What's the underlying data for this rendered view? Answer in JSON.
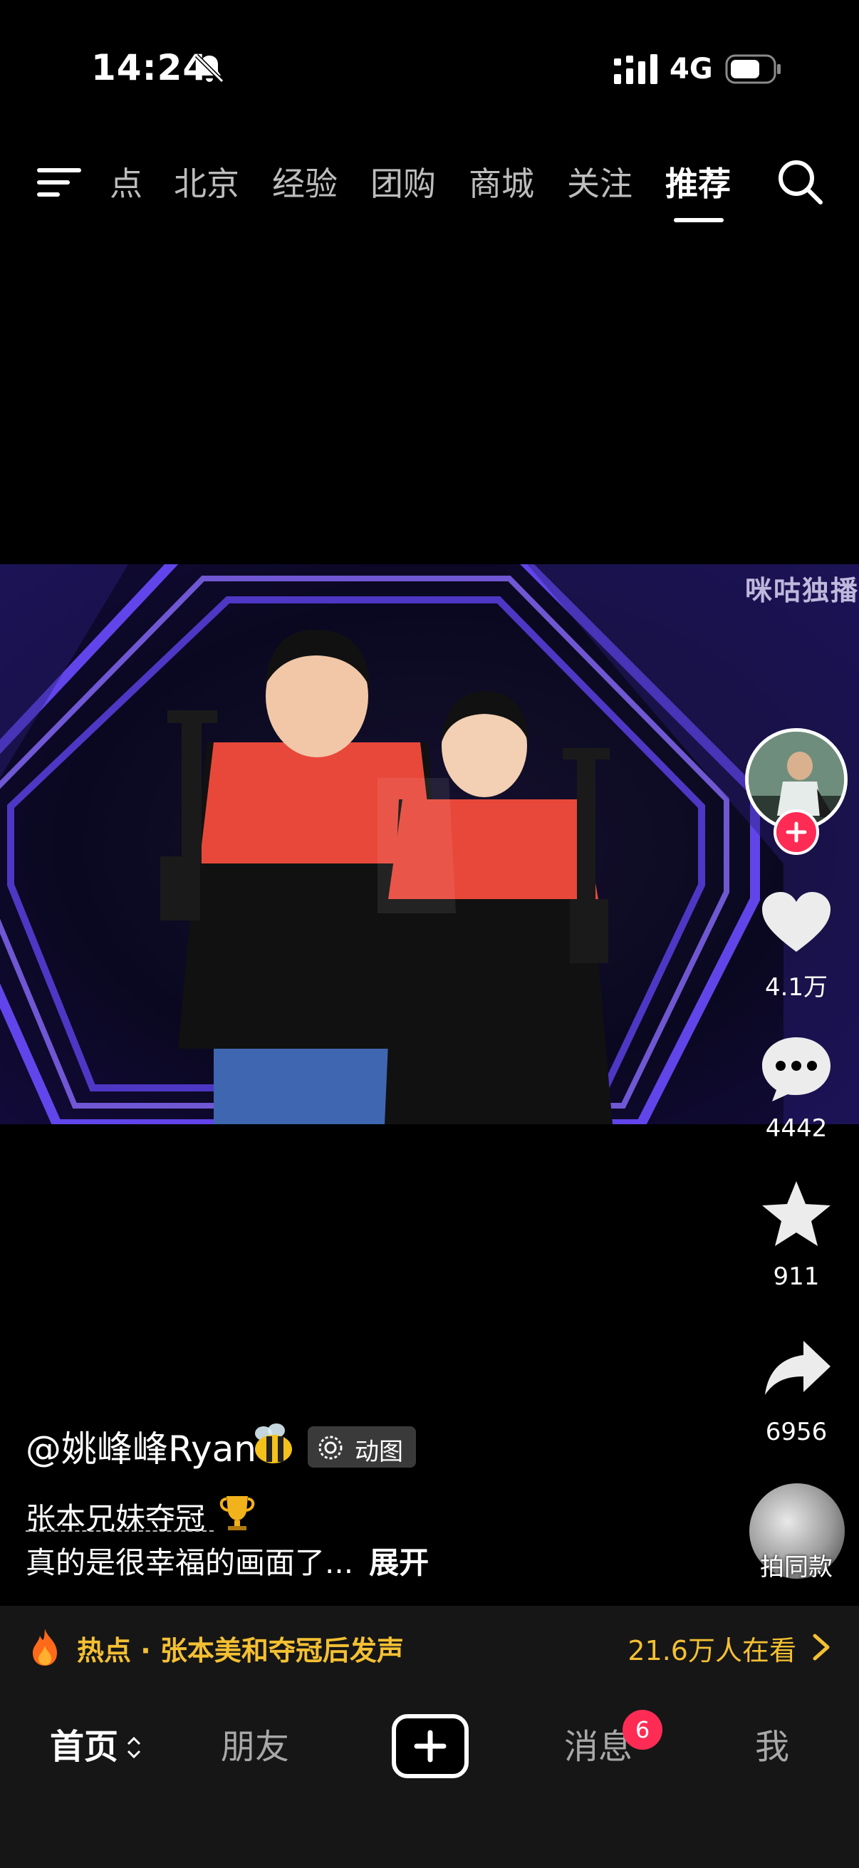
{
  "status_bar": {
    "time": "14:24",
    "network": "4G"
  },
  "top_nav": {
    "tabs": [
      {
        "label": "点"
      },
      {
        "label": "北京"
      },
      {
        "label": "经验"
      },
      {
        "label": "团购"
      },
      {
        "label": "商城"
      },
      {
        "label": "关注"
      },
      {
        "label": "推荐",
        "active": true
      }
    ]
  },
  "video": {
    "watermark": "咪咕独播"
  },
  "actions": {
    "likes": "4.1万",
    "comments": "4442",
    "favorites": "911",
    "shares": "6956",
    "same_style": "拍同款"
  },
  "caption": {
    "author": "@姚峰峰Ryan",
    "chip_label": "动图",
    "title": "张本兄妹夺冠",
    "description": "真的是很幸福的画面了...",
    "expand": "展开"
  },
  "hot_bar": {
    "text": "热点 · 张本美和夺冠后发声",
    "watching": "21.6万人在看"
  },
  "bottom_nav": {
    "home": "首页",
    "friends": "朋友",
    "messages": "消息",
    "message_badge": "6",
    "me": "我"
  },
  "colors": {
    "accent": "#fe2c55",
    "hot": "#f4c033",
    "jersey": "#e8483a"
  },
  "icons": [
    "bell-muted-icon",
    "signal-icon",
    "battery-icon",
    "menu-icon",
    "search-icon",
    "heart-icon",
    "comment-icon",
    "star-icon",
    "share-icon",
    "flame-icon",
    "chevron-right-icon",
    "plus-icon"
  ]
}
